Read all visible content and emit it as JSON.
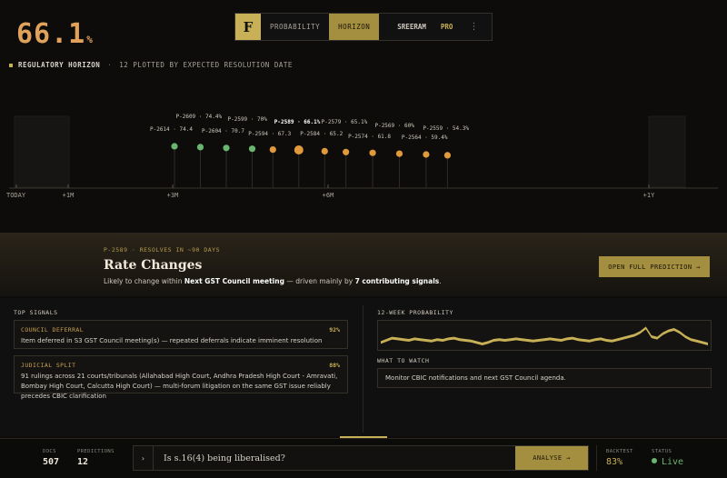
{
  "nav": {
    "logo": "F",
    "tabs": [
      {
        "label": "PROBABILITY",
        "active": false
      },
      {
        "label": "HORIZON",
        "active": true
      }
    ],
    "user": "SREERAM",
    "plan": "PRO",
    "more_glyph": "⋮"
  },
  "horizon": {
    "title": "REGULATORY HORIZON",
    "separator": "·",
    "subtitle": "12 PLOTTED BY EXPECTED RESOLUTION DATE",
    "axis_labels": [
      "TODAY",
      "+1M",
      "+3M",
      "+6M",
      "+1Y"
    ]
  },
  "chart_data": [
    {
      "type": "scatter",
      "title": "REGULATORY HORIZON",
      "x_axis_ticks": [
        "TODAY",
        "+1M",
        "+3M",
        "+6M",
        "+1Y"
      ],
      "points": [
        {
          "id": "P-2614",
          "probability": 74.4,
          "months_out": 3.0,
          "status": "green"
        },
        {
          "id": "P-2609",
          "probability": 74.4,
          "months_out": 3.5,
          "status": "green"
        },
        {
          "id": "P-2604",
          "probability": 70.7,
          "months_out": 4.0,
          "status": "green"
        },
        {
          "id": "P-2599",
          "probability": 70.0,
          "months_out": 4.5,
          "status": "green"
        },
        {
          "id": "P-2594",
          "probability": 67.3,
          "months_out": 4.9,
          "status": "orange"
        },
        {
          "id": "P-2589",
          "probability": 66.1,
          "months_out": 5.4,
          "status": "orange",
          "highlight": true
        },
        {
          "id": "P-2584",
          "probability": 65.2,
          "months_out": 5.9,
          "status": "orange"
        },
        {
          "id": "P-2579",
          "probability": 65.1,
          "months_out": 6.3,
          "status": "orange"
        },
        {
          "id": "P-2574",
          "probability": 61.8,
          "months_out": 6.8,
          "status": "orange"
        },
        {
          "id": "P-2569",
          "probability": 60.0,
          "months_out": 7.3,
          "status": "orange"
        },
        {
          "id": "P-2564",
          "probability": 59.4,
          "months_out": 7.8,
          "status": "orange"
        },
        {
          "id": "P-2559",
          "probability": 54.3,
          "months_out": 8.2,
          "status": "orange"
        }
      ],
      "labels": [
        {
          "text": "P-2614 · 74.4",
          "bold": false
        },
        {
          "text": "P-2609 · 74.4%",
          "bold": false
        },
        {
          "text": "P-2604 · 70.7",
          "bold": false
        },
        {
          "text": "P-2599 · 70%",
          "bold": false
        },
        {
          "text": "P-2594 · 67.3",
          "bold": false
        },
        {
          "text": "P-2589 · 66.1%",
          "bold": true
        },
        {
          "text": "P-2584 · 65.2",
          "bold": false
        },
        {
          "text": "P-2579 · 65.1%",
          "bold": false
        },
        {
          "text": "P-2574 · 61.8",
          "bold": false
        },
        {
          "text": "P-2569 · 60%",
          "bold": false
        },
        {
          "text": "P-2564 · 59.4%",
          "bold": false
        },
        {
          "text": "P-2559 · 54.3%",
          "bold": false
        }
      ]
    },
    {
      "type": "area",
      "title": "12-WEEK PROBABILITY",
      "series": [
        {
          "values": [
            52,
            55,
            58,
            57,
            56,
            55,
            57,
            56,
            55,
            54,
            56,
            55,
            57,
            58,
            56,
            55,
            54,
            52,
            50,
            52,
            55,
            56,
            55,
            56,
            57,
            56,
            55,
            54,
            55,
            56,
            57,
            56,
            55,
            57,
            58,
            56,
            55,
            54,
            56,
            57,
            55,
            54,
            56,
            58,
            60,
            62,
            66,
            72,
            60,
            58,
            64,
            68,
            70,
            66,
            60,
            56,
            54,
            52,
            50
          ]
        }
      ]
    }
  ],
  "hero": {
    "value": "66.1",
    "unit": "%",
    "meta": "P-2589 · RESOLVES IN ~90 DAYS",
    "title": "Rate Changes",
    "desc_prefix": "Likely to change within ",
    "desc_event": "Next GST Council meeting",
    "desc_mid": " — driven mainly by ",
    "desc_signals": "7 contributing signals",
    "desc_suffix": ".",
    "open_button": "OPEN FULL PREDICTION →"
  },
  "top_signals": {
    "label": "TOP SIGNALS",
    "items": [
      {
        "name": "COUNCIL DEFERRAL",
        "pct": "92%",
        "text": "Item deferred in S3 GST Council meeting(s) — repeated deferrals indicate imminent resolution"
      },
      {
        "name": "JUDICIAL SPLIT",
        "pct": "88%",
        "text": "91 rulings across 21 courts/tribunals (Allahabad High Court, Andhra Pradesh High Court - Amravati, Bombay High Court, Calcutta High Court) — multi-forum litigation on the same GST issue reliably precedes CBIC clarification"
      }
    ]
  },
  "probability_panel": {
    "label": "12-WEEK PROBABILITY"
  },
  "watch": {
    "label": "WHAT TO WATCH",
    "text": "Monitor CBIC notifications and next GST Council agenda."
  },
  "bottom": {
    "docs_label": "DOCS",
    "docs_value": "507",
    "predictions_label": "PREDICTIONS",
    "predictions_value": "12",
    "query_arrow": "›",
    "query_placeholder": "Is s.16(4) being liberalised?",
    "analyse_button": "ANALYSE →",
    "backtest_label": "BACKTEST",
    "backtest_value": "83%",
    "status_label": "STATUS",
    "status_value": "Live"
  },
  "colors": {
    "accent": "#c8b056",
    "accent_dark": "#a48e3f",
    "green": "#6ab56f",
    "orange": "#e09a3c",
    "hero_number": "#e0a15a"
  }
}
